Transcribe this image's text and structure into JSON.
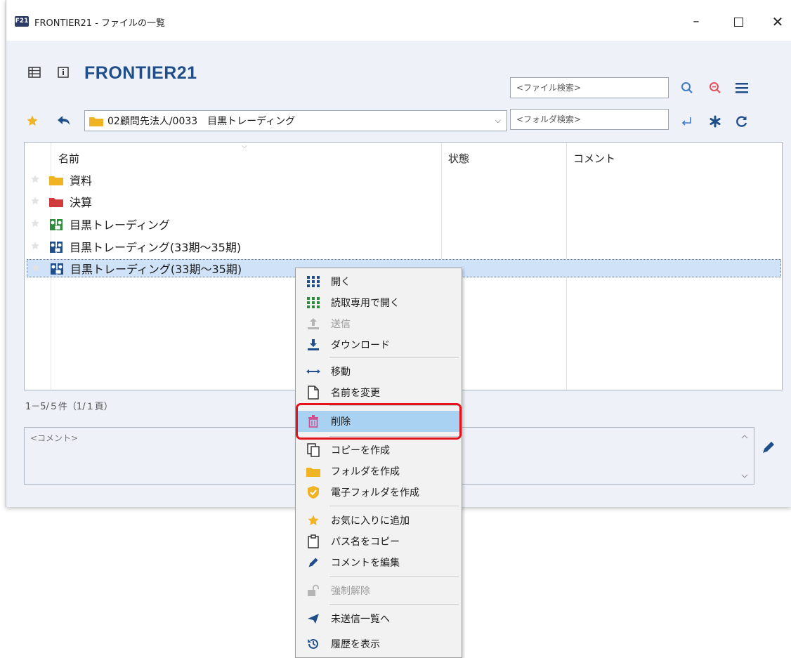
{
  "window": {
    "app_badge": "F21",
    "title": "FRONTIER21 - ファイルの一覧"
  },
  "header": {
    "app_name": "FRONTIER21",
    "file_search_placeholder": "<ファイル検索>",
    "folder_search_placeholder": "<フォルダ検索>"
  },
  "path": {
    "current": "02顧問先法人/0033　目黒トレーディング"
  },
  "list": {
    "columns": [
      "名前",
      "状態",
      "コメント"
    ],
    "rows": [
      {
        "name": "資料",
        "icon": "folder-yellow-icon"
      },
      {
        "name": "決算",
        "icon": "folder-red-icon"
      },
      {
        "name": "目黒トレーディング",
        "icon": "binder-green-icon"
      },
      {
        "name": "目黒トレーディング(33期～35期)",
        "icon": "binder-blue-icon"
      },
      {
        "name": "目黒トレーディング(33期～35期)",
        "icon": "binder-blue-icon",
        "selected": true
      }
    ],
    "page_count": "1－5/５件（1/１頁）"
  },
  "comment": {
    "placeholder": "<コメント>"
  },
  "context_menu": {
    "items": [
      {
        "label": "開く",
        "icon": "grid-icon"
      },
      {
        "label": "読取専用で開く",
        "icon": "grid-green-icon"
      },
      {
        "label": "送信",
        "icon": "upload-icon",
        "disabled": true
      },
      {
        "label": "ダウンロード",
        "icon": "download-icon"
      },
      {
        "label": "移動",
        "icon": "move-arrow-icon"
      },
      {
        "label": "名前を変更",
        "icon": "document-icon"
      },
      {
        "label": "削除",
        "icon": "trash-icon",
        "highlighted": true
      },
      {
        "label": "コピーを作成",
        "icon": "copy-icon"
      },
      {
        "label": "フォルダを作成",
        "icon": "folder-icon"
      },
      {
        "label": "電子フォルダを作成",
        "icon": "shield-check-icon"
      },
      {
        "label": "お気に入りに追加",
        "icon": "star-icon"
      },
      {
        "label": "パス名をコピー",
        "icon": "clipboard-icon"
      },
      {
        "label": "コメントを編集",
        "icon": "pencil-icon"
      },
      {
        "label": "強制解除",
        "icon": "unlock-icon",
        "disabled": true
      },
      {
        "label": "未送信一覧へ",
        "icon": "send-icon"
      },
      {
        "label": "履歴を表示",
        "icon": "history-icon"
      }
    ]
  },
  "colors": {
    "accent": "#1f4e8a",
    "selection": "#cfe2f7",
    "menu_highlight": "#a9d1f2",
    "callout_red": "#e0141e"
  }
}
